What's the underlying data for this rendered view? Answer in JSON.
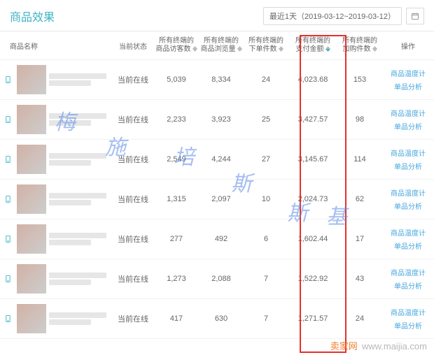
{
  "header": {
    "title": "商品效果",
    "date_label": "最近1天（2019-03-12~2019-03-12）"
  },
  "columns": {
    "name": "商品名称",
    "status": "当前状态",
    "visitors_l1": "所有终端的",
    "visitors_l2": "商品访客数",
    "views_l1": "所有终端的",
    "views_l2": "商品浏览量",
    "orders_l1": "所有终端的",
    "orders_l2": "下单件数",
    "pay_l1": "所有终端的",
    "pay_l2": "支付金额",
    "cart_l1": "所有终端的",
    "cart_l2": "加购件数",
    "ops": "操作"
  },
  "link_labels": {
    "thermo": "商品温度计",
    "single": "单品分析"
  },
  "rows": [
    {
      "status": "当前在线",
      "visitors": "5,039",
      "views": "8,334",
      "orders": "24",
      "pay": "4,023.68",
      "cart": "153"
    },
    {
      "status": "当前在线",
      "visitors": "2,233",
      "views": "3,923",
      "orders": "25",
      "pay": "3,427.57",
      "cart": "98"
    },
    {
      "status": "当前在线",
      "visitors": "2,549",
      "views": "4,244",
      "orders": "27",
      "pay": "3,145.67",
      "cart": "114"
    },
    {
      "status": "当前在线",
      "visitors": "1,315",
      "views": "2,097",
      "orders": "10",
      "pay": "2,024.73",
      "cart": "62"
    },
    {
      "status": "当前在线",
      "visitors": "277",
      "views": "492",
      "orders": "6",
      "pay": "1,602.44",
      "cart": "17"
    },
    {
      "status": "当前在线",
      "visitors": "1,273",
      "views": "2,088",
      "orders": "7",
      "pay": "1,522.92",
      "cart": "43"
    },
    {
      "status": "当前在线",
      "visitors": "417",
      "views": "630",
      "orders": "7",
      "pay": "1,271.57",
      "cart": "24"
    }
  ],
  "watermarks": [
    "梅",
    "施",
    "培",
    "斯",
    "斯",
    "基"
  ],
  "footer": {
    "brand": "卖家网",
    "url": "www.maijia.com"
  }
}
